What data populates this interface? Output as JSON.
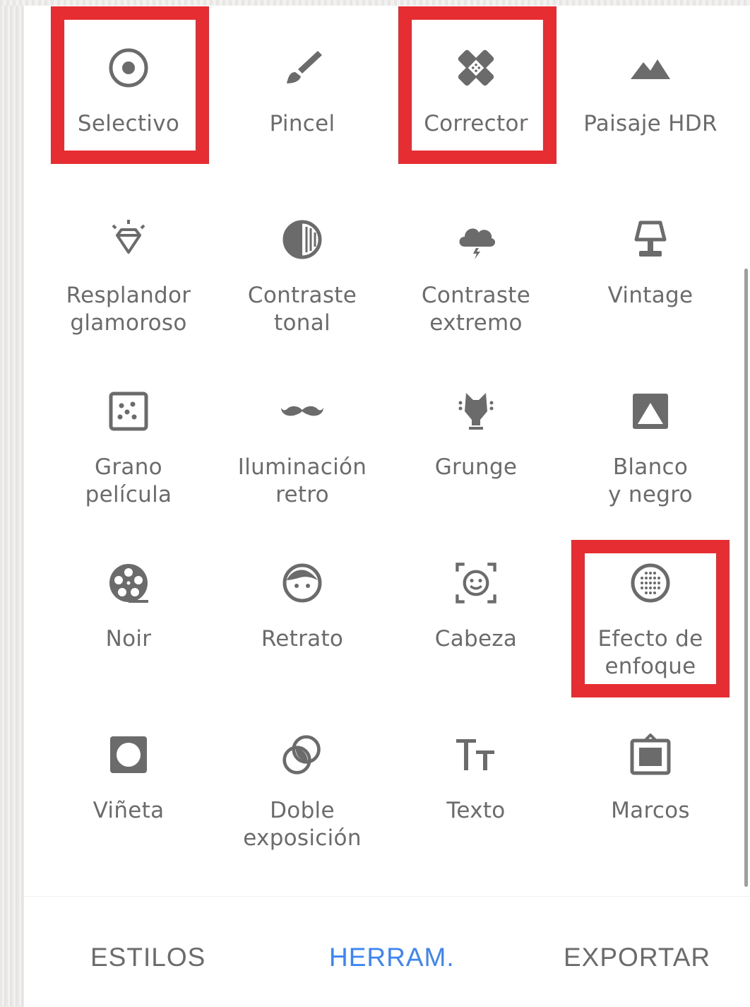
{
  "tools": [
    {
      "label": "Selectivo",
      "icon": "selective-target-icon"
    },
    {
      "label": "Pincel",
      "icon": "brush-icon"
    },
    {
      "label": "Corrector",
      "icon": "bandage-icon"
    },
    {
      "label": "Paisaje HDR",
      "icon": "mountains-icon"
    },
    {
      "label": "Resplandor\nglamoroso",
      "icon": "diamond-glow-icon"
    },
    {
      "label": "Contraste\ntonal",
      "icon": "tonal-circle-icon"
    },
    {
      "label": "Contraste\nextremo",
      "icon": "storm-cloud-icon"
    },
    {
      "label": "Vintage",
      "icon": "lamp-icon"
    },
    {
      "label": "Grano\npelícula",
      "icon": "film-grain-icon"
    },
    {
      "label": "Iluminación\nretro",
      "icon": "mustache-icon"
    },
    {
      "label": "Grunge",
      "icon": "grunge-guitar-icon"
    },
    {
      "label": "Blanco\ny negro",
      "icon": "black-white-icon"
    },
    {
      "label": "Noir",
      "icon": "film-reel-icon"
    },
    {
      "label": "Retrato",
      "icon": "portrait-face-icon"
    },
    {
      "label": "Cabeza",
      "icon": "face-scan-icon"
    },
    {
      "label": "Efecto de\nenfoque",
      "icon": "lens-blur-icon"
    },
    {
      "label": "Viñeta",
      "icon": "vignette-icon"
    },
    {
      "label": "Doble\nexposición",
      "icon": "double-exposure-icon"
    },
    {
      "label": "Texto",
      "icon": "text-tt-icon"
    },
    {
      "label": "Marcos",
      "icon": "frame-icon"
    }
  ],
  "highlighted": [
    "Selectivo",
    "Corrector",
    "Efecto de\nenfoque"
  ],
  "colors": {
    "highlight": "#e62d32",
    "active_tab": "#3d84f5",
    "text": "#6b6b6b"
  },
  "tabs": {
    "styles": "ESTILOS",
    "tools": "HERRAM.",
    "export": "EXPORTAR"
  }
}
